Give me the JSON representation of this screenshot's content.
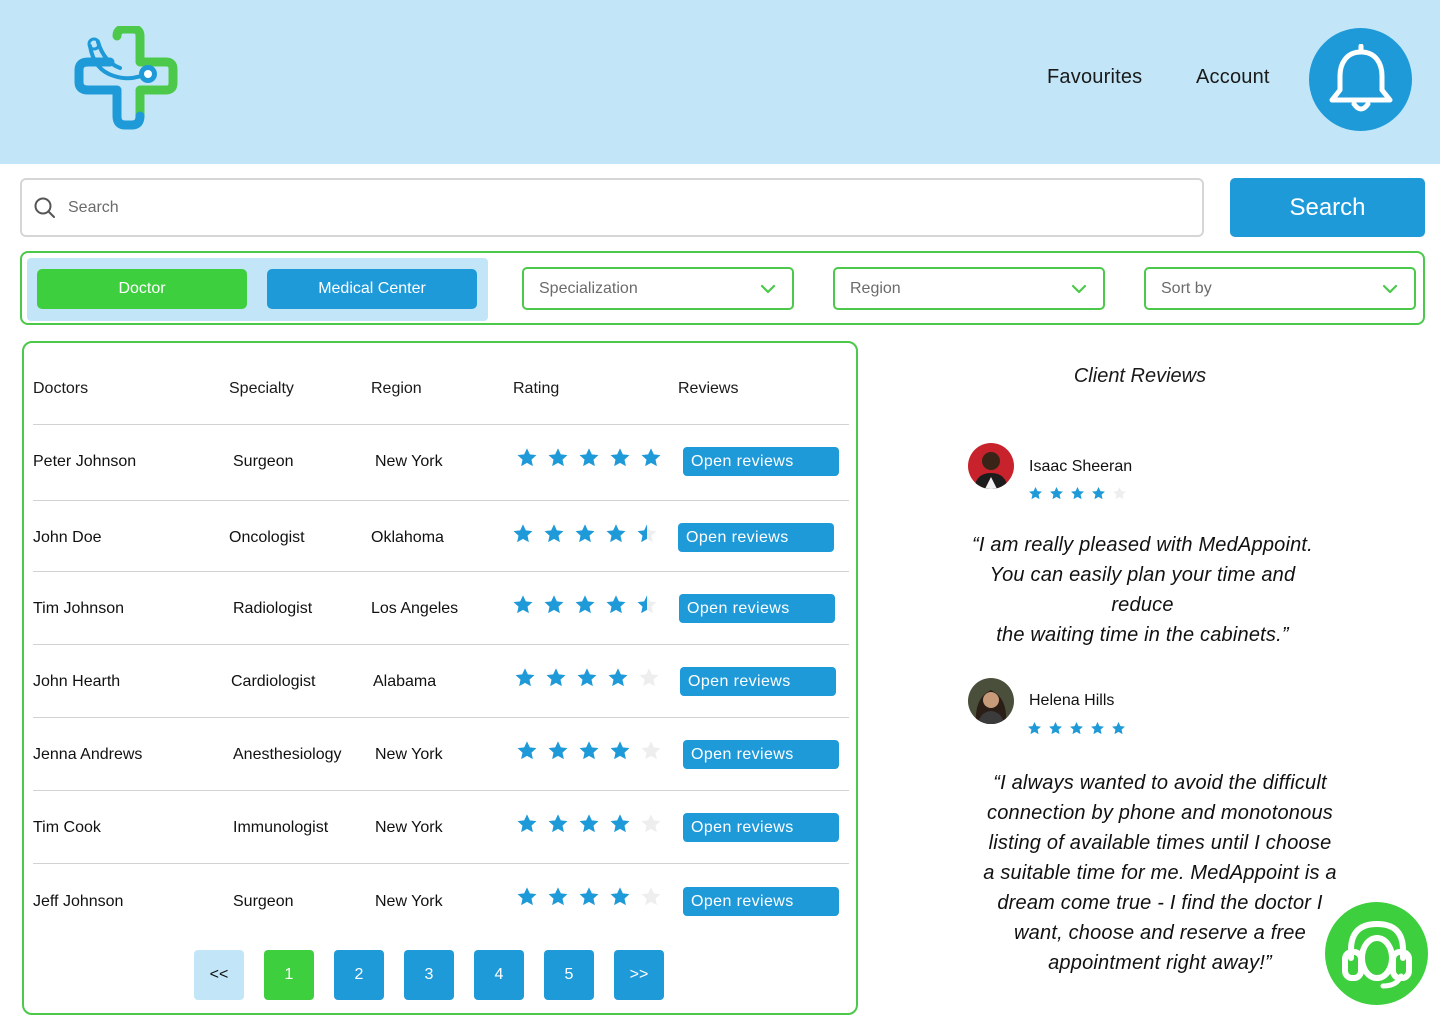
{
  "colors": {
    "header_bg": "#c2e6f8",
    "primary_blue": "#1f9ad9",
    "accent_green": "#3ecf3e",
    "border_green": "#4cc94a",
    "star_empty": "#eeeeee"
  },
  "header": {
    "logo_icon": "medical-cross-stethoscope-logo",
    "nav": [
      "Favourites",
      "Account"
    ],
    "notification_icon": "bell-icon"
  },
  "search": {
    "placeholder": "Search",
    "button_label": "Search",
    "icon": "search-icon"
  },
  "filters": {
    "toggle": [
      "Doctor",
      "Medical Center"
    ],
    "active_toggle": "Doctor",
    "dropdowns": [
      "Specialization",
      "Region",
      "Sort by"
    ]
  },
  "table": {
    "headers": [
      "Doctors",
      "Specialty",
      "Region",
      "Rating",
      "Reviews"
    ],
    "rows": [
      {
        "name": "Peter Johnson",
        "specialty": "Surgeon",
        "region": "New York",
        "rating": 5,
        "button": "Open reviews"
      },
      {
        "name": "John Doe",
        "specialty": "Oncologist",
        "region": "Oklahoma",
        "rating": 4.5,
        "button": "Open reviews"
      },
      {
        "name": "Tim Johnson",
        "specialty": "Radiologist",
        "region": "Los Angeles",
        "rating": 4.5,
        "button": "Open reviews"
      },
      {
        "name": "John Hearth",
        "specialty": "Cardiologist",
        "region": "Alabama",
        "rating": 4,
        "button": "Open reviews"
      },
      {
        "name": "Jenna Andrews",
        "specialty": "Anesthesiology",
        "region": "New York",
        "rating": 4,
        "button": "Open reviews"
      },
      {
        "name": "Tim Cook",
        "specialty": "Immunologist",
        "region": "New York",
        "rating": 4,
        "button": "Open reviews"
      },
      {
        "name": "Jeff Johnson",
        "specialty": "Surgeon",
        "region": "New York",
        "rating": 4,
        "button": "Open reviews"
      }
    ]
  },
  "pagination": {
    "prev": "<<",
    "pages": [
      "1",
      "2",
      "3",
      "4",
      "5"
    ],
    "current": "1",
    "next": ">>"
  },
  "reviews": {
    "title": "Client Reviews",
    "items": [
      {
        "name": "Isaac Sheeran",
        "rating": 4,
        "quote_lines": [
          "“I am really pleased with MedAppoint.",
          "You can easily plan your time and",
          "reduce",
          "the waiting time in the cabinets.”"
        ]
      },
      {
        "name": "Helena Hills",
        "rating": 5,
        "quote_lines": [
          "“I always wanted to avoid the difficult",
          "connection by phone and monotonous",
          "listing of available times until I choose",
          "a suitable time for me. MedAppoint is a",
          "dream come true - I find the doctor I",
          "want, choose and reserve a free",
          "appointment right away!”"
        ]
      }
    ]
  },
  "support_icon": "headset-support-icon"
}
